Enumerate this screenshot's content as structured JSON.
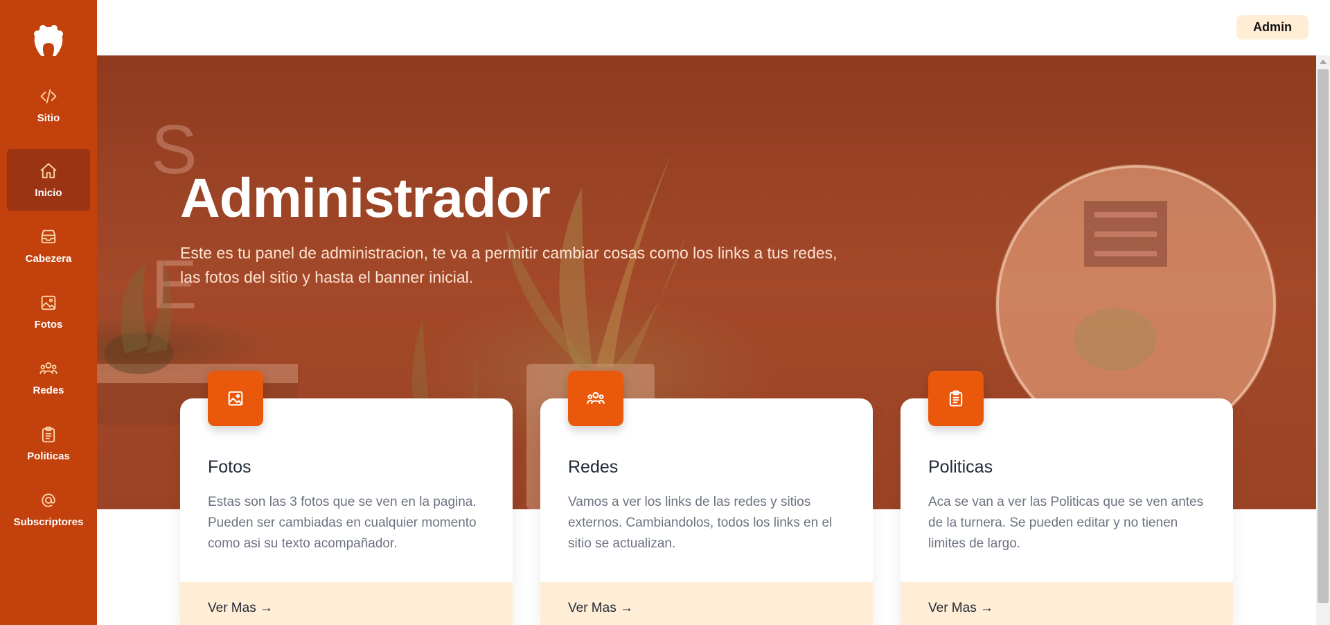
{
  "sidebar": {
    "items": [
      {
        "label": "Sitio",
        "icon": "code-icon"
      },
      {
        "label": "Inicio",
        "icon": "home-icon",
        "active": true
      },
      {
        "label": "Cabezera",
        "icon": "inbox-stack-icon"
      },
      {
        "label": "Fotos",
        "icon": "image-icon"
      },
      {
        "label": "Redes",
        "icon": "users-icon"
      },
      {
        "label": "Politicas",
        "icon": "clipboard-icon"
      },
      {
        "label": "Subscriptores",
        "icon": "at-sign-icon"
      }
    ]
  },
  "header": {
    "user_label": "Admin"
  },
  "hero": {
    "title": "Administrador",
    "subtitle": "Este es tu panel de administracion, te va a permitir cambiar cosas como los links a tus redes, las fotos del sitio y hasta el banner inicial."
  },
  "cards": [
    {
      "title": "Fotos",
      "text": "Estas son las 3 fotos que se ven en la pagina. Pueden ser cambiadas en cualquier momento como asi su texto acompañador.",
      "link": "Ver Mas →",
      "icon": "image-icon"
    },
    {
      "title": "Redes",
      "text": "Vamos a ver los links de las redes y sitios externos. Cambiandolos, todos los links en el sitio se actualizan.",
      "link": "Ver Mas →",
      "icon": "users-icon"
    },
    {
      "title": "Politicas",
      "text": "Aca se van a ver las Politicas que se ven antes de la turnera. Se pueden editar y no tienen limites de largo.",
      "link": "Ver Mas →",
      "icon": "clipboard-icon"
    }
  ],
  "colors": {
    "sidebar": "#c2410c",
    "sidebar_active": "#9a3412",
    "accent": "#ea580c",
    "card_footer": "#ffedd5"
  }
}
